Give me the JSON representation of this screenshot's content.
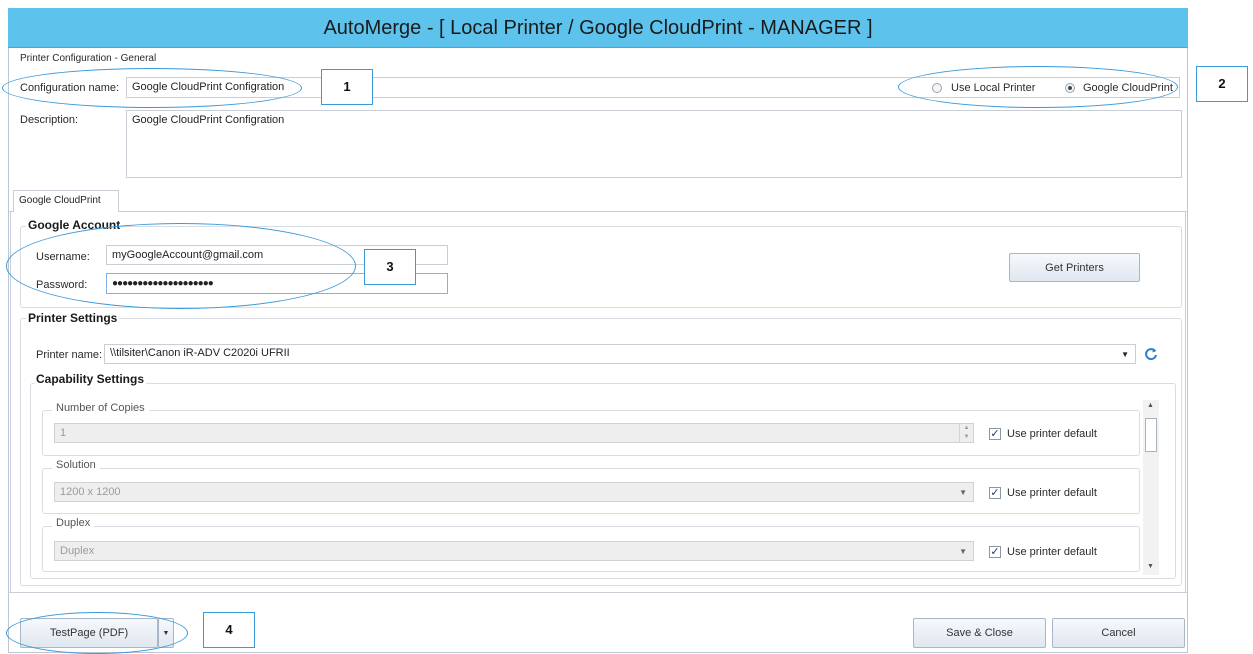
{
  "window": {
    "title": "AutoMerge - [ Local Printer / Google CloudPrint - MANAGER ]"
  },
  "general": {
    "section_label": "Printer Configuration - General",
    "config_name_label": "Configuration name:",
    "config_name_value": "Google CloudPrint Configration",
    "description_label": "Description:",
    "description_value": "Google CloudPrint Configration",
    "radio_local": "Use Local Printer",
    "radio_cloud": "Google CloudPrint",
    "selected_radio": "Google CloudPrint"
  },
  "tabs": [
    {
      "label": "Google CloudPrint",
      "active": true
    }
  ],
  "account": {
    "title": "Google Account",
    "username_label": "Username:",
    "username_value": "myGoogleAccount@gmail.com",
    "password_label": "Password:",
    "password_value": "●●●●●●●●●●●●●●●●●●●●",
    "get_printers_label": "Get Printers"
  },
  "printer_settings": {
    "title": "Printer Settings",
    "printer_name_label": "Printer name:",
    "printer_name_value": "\\\\tilsiter\\Canon iR-ADV C2020i UFRII",
    "capability_title": "Capability Settings",
    "capabilities": [
      {
        "label": "Number of Copies",
        "value": "1",
        "control": "spinner",
        "default_label": "Use printer default",
        "checked": true
      },
      {
        "label": "Solution",
        "value": "1200 x 1200",
        "control": "dropdown",
        "default_label": "Use printer default",
        "checked": true
      },
      {
        "label": "Duplex",
        "value": "Duplex",
        "control": "dropdown",
        "default_label": "Use printer default",
        "checked": true
      }
    ]
  },
  "footer": {
    "testpage_label": "TestPage (PDF)",
    "save_close_label": "Save & Close",
    "cancel_label": "Cancel"
  },
  "callouts": [
    "1",
    "2",
    "3",
    "4"
  ],
  "colors": {
    "titlebar": "#5ec3ec",
    "callout_border": "#3a9ad9"
  }
}
